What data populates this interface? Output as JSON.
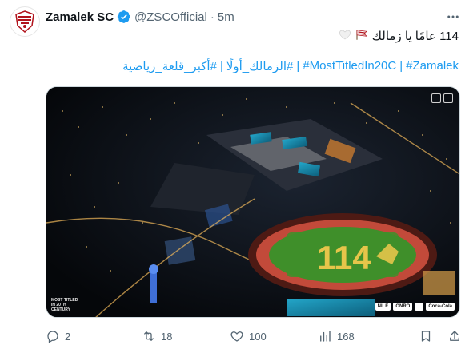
{
  "account": {
    "name": "Zamalek SC",
    "handle": "@ZSCOfficial",
    "separator": "·",
    "time": "5m",
    "verified_icon": "verified-badge-icon"
  },
  "tweet": {
    "text": "114 عامًا يا زمالك",
    "hashtags": [
      "#أكبر_قلعة_رياضية",
      "#الزمالك_أولًا",
      "#MostTitledIn20C",
      "#Zamalek"
    ],
    "hashtag_separator": "|"
  },
  "media": {
    "field_number": "114",
    "caption_left": "MOST TITLED IN 20TH CENTURY",
    "sponsors": [
      "NILE",
      "ONRO",
      "...",
      "Coca-Cola"
    ]
  },
  "actions": {
    "replies": "2",
    "retweets": "18",
    "likes": "100",
    "views": "168"
  },
  "colors": {
    "accent": "#1d9bf0",
    "muted": "#536471",
    "field_green": "#3f8f2a",
    "track_red": "#c24a3a",
    "number_gold": "#e6c54a"
  }
}
